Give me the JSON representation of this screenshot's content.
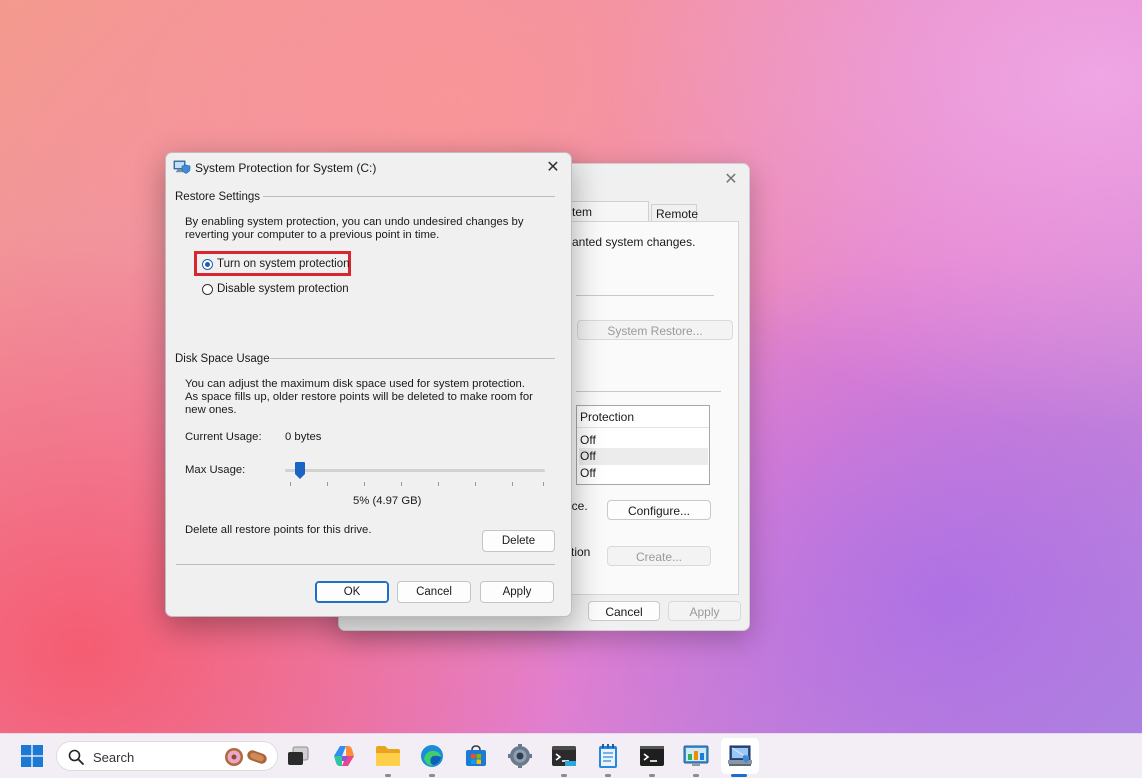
{
  "background_window": {
    "tabs": {
      "active": "stem Protection",
      "remote": "Remote"
    },
    "description_partial": "anted system changes.",
    "system_restore_button": "System Restore...",
    "list_header": "Protection",
    "list_rows": [
      "Off",
      "Off",
      "Off"
    ],
    "configure_partial_label": "ace.",
    "configure_button": "Configure...",
    "create_partial_label": "ction",
    "create_button": "Create...",
    "buttons": {
      "cancel": "Cancel",
      "apply": "Apply"
    }
  },
  "dialog": {
    "title": "System Protection for System (C:)",
    "restore_settings": {
      "group_label": "Restore Settings",
      "description": "By enabling system protection, you can undo undesired changes by reverting your computer to a previous point in time.",
      "options": [
        {
          "label": "Turn on system protection",
          "selected": true
        },
        {
          "label": "Disable system protection",
          "selected": false
        }
      ]
    },
    "disk_space": {
      "group_label": "Disk Space Usage",
      "description": "You can adjust the maximum disk space used for system protection. As space fills up, older restore points will be deleted to make room for new ones.",
      "current_usage_label": "Current Usage:",
      "current_usage_value": "0 bytes",
      "max_usage_label": "Max Usage:",
      "max_usage_percent": 5,
      "max_usage_text": "5% (4.97 GB)",
      "delete_text": "Delete all restore points for this drive.",
      "delete_button": "Delete"
    },
    "buttons": {
      "ok": "OK",
      "cancel": "Cancel",
      "apply": "Apply"
    }
  },
  "taskbar": {
    "search_placeholder": "Search",
    "icons": [
      "start-icon",
      "search-icon",
      "task-view-icon",
      "copilot-icon",
      "file-explorer-icon",
      "edge-icon",
      "store-icon",
      "settings-icon",
      "terminal-icon",
      "notepad-icon",
      "command-prompt-icon",
      "control-panel-icon",
      "system-properties-icon"
    ]
  },
  "colors": {
    "highlight_border": "#d72630",
    "accent": "#1f6fc9"
  }
}
